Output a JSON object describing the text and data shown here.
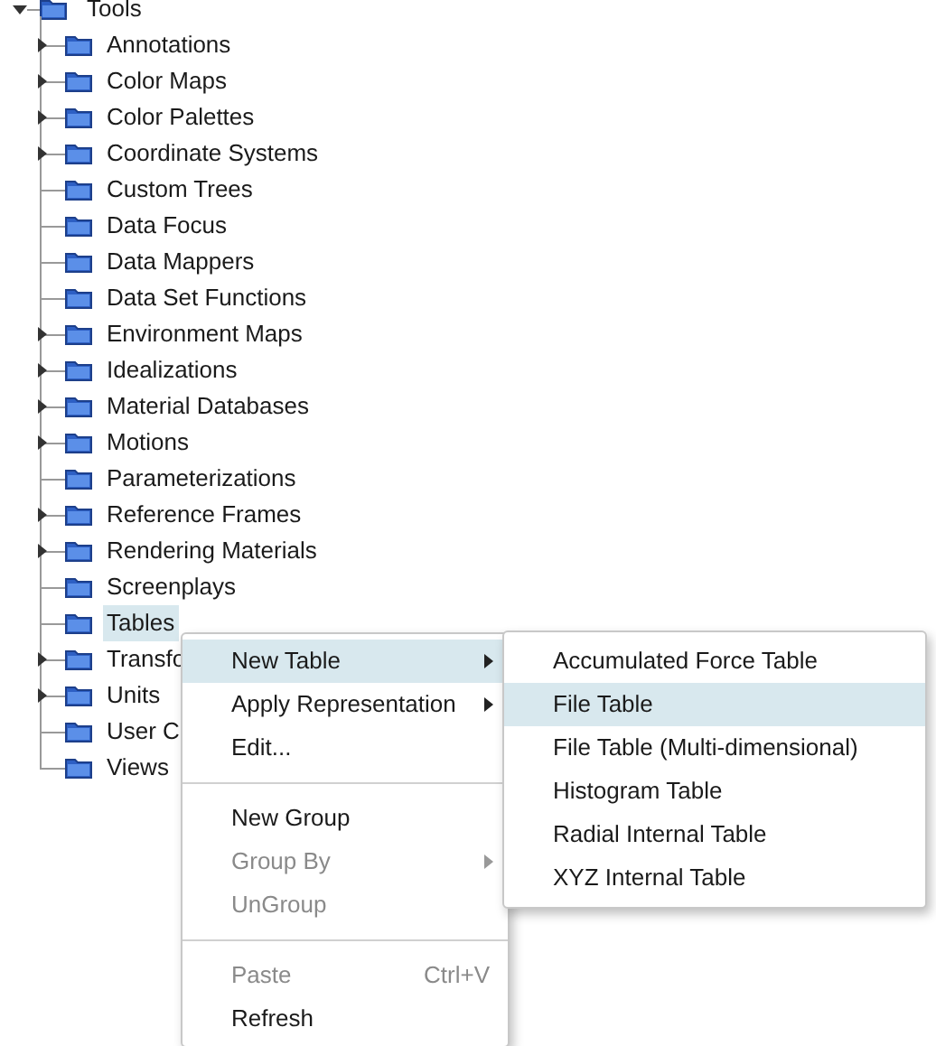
{
  "tree": {
    "label": "Tools",
    "expanded": true,
    "children": [
      {
        "label": "Annotations",
        "expandable": true,
        "selected": false
      },
      {
        "label": "Color Maps",
        "expandable": true,
        "selected": false
      },
      {
        "label": "Color Palettes",
        "expandable": true,
        "selected": false
      },
      {
        "label": "Coordinate Systems",
        "expandable": true,
        "selected": false
      },
      {
        "label": "Custom Trees",
        "expandable": false,
        "selected": false
      },
      {
        "label": "Data Focus",
        "expandable": false,
        "selected": false
      },
      {
        "label": "Data Mappers",
        "expandable": false,
        "selected": false
      },
      {
        "label": "Data Set Functions",
        "expandable": false,
        "selected": false
      },
      {
        "label": "Environment Maps",
        "expandable": true,
        "selected": false
      },
      {
        "label": "Idealizations",
        "expandable": true,
        "selected": false
      },
      {
        "label": "Material Databases",
        "expandable": true,
        "selected": false
      },
      {
        "label": "Motions",
        "expandable": true,
        "selected": false
      },
      {
        "label": "Parameterizations",
        "expandable": false,
        "selected": false
      },
      {
        "label": "Reference Frames",
        "expandable": true,
        "selected": false
      },
      {
        "label": "Rendering Materials",
        "expandable": true,
        "selected": false
      },
      {
        "label": "Screenplays",
        "expandable": false,
        "selected": false
      },
      {
        "label": "Tables",
        "expandable": false,
        "selected": true
      },
      {
        "label": "Transfo",
        "expandable": true,
        "selected": false
      },
      {
        "label": "Units",
        "expandable": true,
        "selected": false
      },
      {
        "label": "User C",
        "expandable": false,
        "selected": false
      },
      {
        "label": "Views",
        "expandable": false,
        "selected": false
      }
    ]
  },
  "context_menu": [
    {
      "kind": "item",
      "label": "New Table",
      "submenu": true,
      "disabled": false,
      "selected": true
    },
    {
      "kind": "item",
      "label": "Apply Representation",
      "submenu": true,
      "disabled": false,
      "selected": false
    },
    {
      "kind": "item",
      "label": "Edit...",
      "submenu": false,
      "disabled": false,
      "selected": false
    },
    {
      "kind": "separator"
    },
    {
      "kind": "item",
      "label": "New Group",
      "submenu": false,
      "disabled": false,
      "selected": false
    },
    {
      "kind": "item",
      "label": "Group By",
      "submenu": true,
      "disabled": true,
      "selected": false
    },
    {
      "kind": "item",
      "label": "UnGroup",
      "submenu": false,
      "disabled": true,
      "selected": false
    },
    {
      "kind": "separator"
    },
    {
      "kind": "item",
      "label": "Paste",
      "shortcut": "Ctrl+V",
      "submenu": false,
      "disabled": true,
      "selected": false
    },
    {
      "kind": "item",
      "label": "Refresh",
      "submenu": false,
      "disabled": false,
      "selected": false
    }
  ],
  "submenu": [
    {
      "label": "Accumulated Force Table",
      "selected": false
    },
    {
      "label": "File Table",
      "selected": true
    },
    {
      "label": "File Table (Multi-dimensional)",
      "selected": false
    },
    {
      "label": "Histogram Table",
      "selected": false
    },
    {
      "label": "Radial Internal Table",
      "selected": false
    },
    {
      "label": "XYZ Internal Table",
      "selected": false
    }
  ]
}
